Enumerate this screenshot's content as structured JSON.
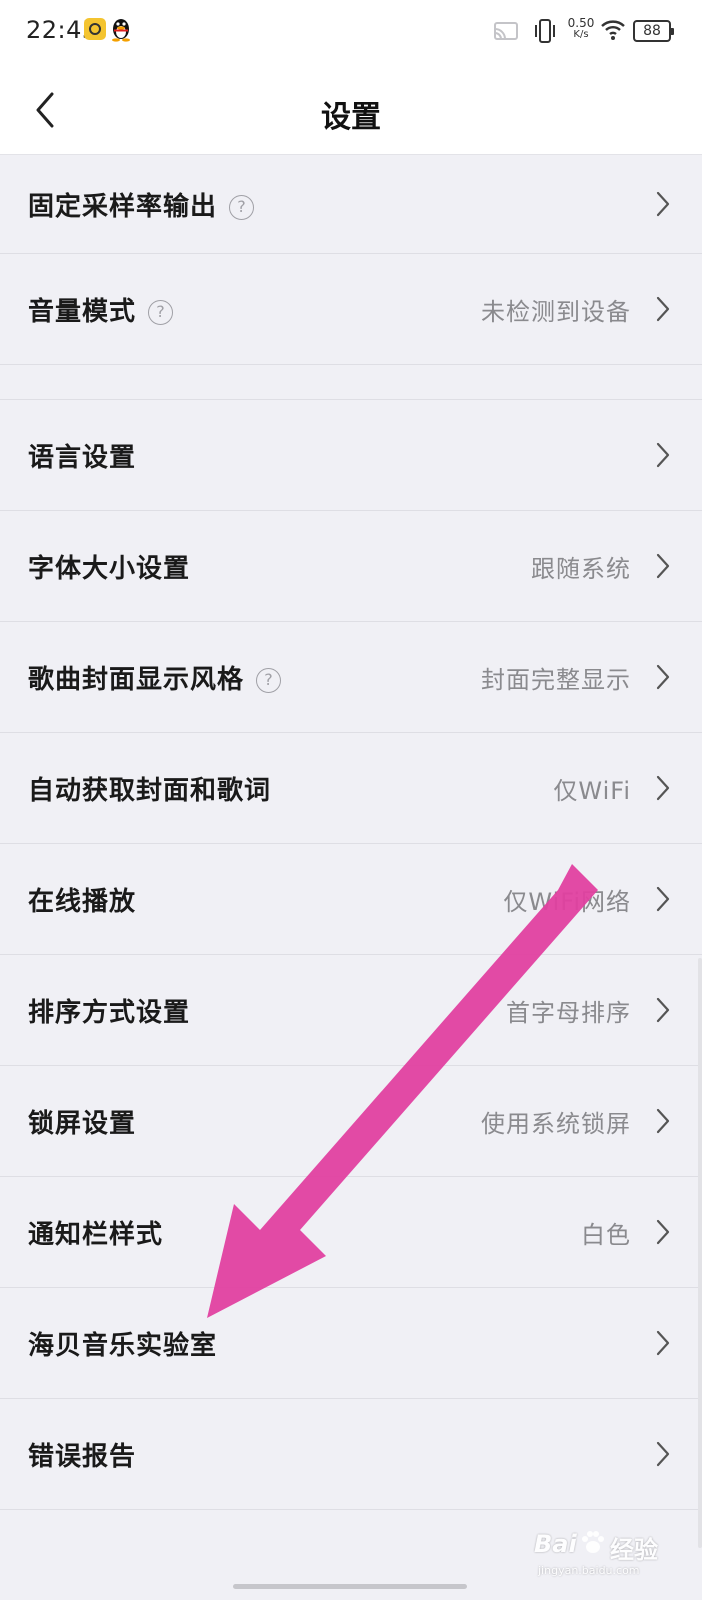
{
  "status_bar": {
    "time": "22:45",
    "net_speed_value": "0.50",
    "net_speed_unit": "K/s",
    "battery": "88",
    "icons": [
      "app-badge-icon",
      "qq-penguin-icon",
      "cast-icon",
      "vibrate-icon",
      "wifi-icon",
      "battery-icon"
    ]
  },
  "header": {
    "title": "设置",
    "back_icon": "chevron-left-icon"
  },
  "settings": [
    {
      "label": "固定采样率输出",
      "value": "",
      "help": "?"
    },
    {
      "label": "音量模式",
      "value": "未检测到设备",
      "help": "?"
    },
    {
      "label": "语言设置",
      "value": ""
    },
    {
      "label": "字体大小设置",
      "value": "跟随系统"
    },
    {
      "label": "歌曲封面显示风格",
      "value": "封面完整显示",
      "help": "?"
    },
    {
      "label": "自动获取封面和歌词",
      "value": "仅WiFi"
    },
    {
      "label": "在线播放",
      "value": "仅WiFi网络"
    },
    {
      "label": "排序方式设置",
      "value": "首字母排序"
    },
    {
      "label": "锁屏设置",
      "value": "使用系统锁屏"
    },
    {
      "label": "通知栏样式",
      "value": "白色"
    },
    {
      "label": "海贝音乐实验室",
      "value": ""
    },
    {
      "label": "错误报告",
      "value": ""
    }
  ],
  "annotation": {
    "arrow_color": "#e040a0",
    "points_to": "海贝音乐实验室"
  },
  "watermark": {
    "brand": "Bai",
    "brand_suffix": "经验",
    "url": "jingyan.baidu.com"
  },
  "colors": {
    "background": "#f0f0f5",
    "surface": "#ffffff",
    "value_text": "#8a8a8e",
    "divider": "#dedee4"
  }
}
